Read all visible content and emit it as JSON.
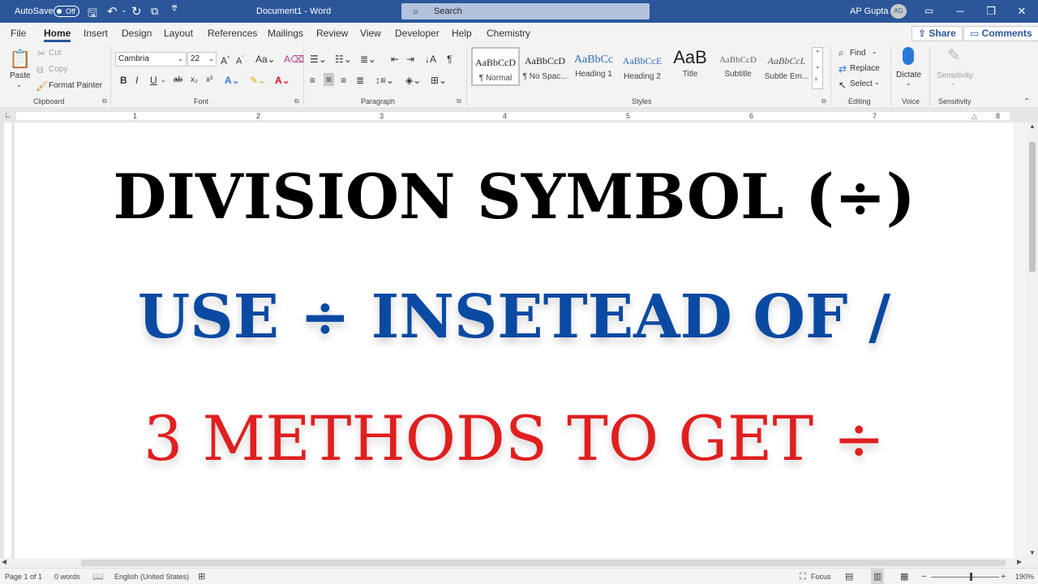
{
  "titlebar": {
    "autosave_label": "AutoSave",
    "autosave_state": "Off",
    "doc_title": "Document1  -  Word",
    "search_placeholder": "Search",
    "user_name": "AP Gupta",
    "user_initials": "AG"
  },
  "menu": {
    "tabs": [
      "File",
      "Home",
      "Insert",
      "Design",
      "Layout",
      "References",
      "Mailings",
      "Review",
      "View",
      "Developer",
      "Help",
      "Chemistry"
    ],
    "active_tab": "Home",
    "share_label": "Share",
    "comments_label": "Comments"
  },
  "ribbon": {
    "clipboard": {
      "paste_label": "Paste",
      "cut_label": "Cut",
      "copy_label": "Copy",
      "format_painter_label": "Format Painter",
      "group_label": "Clipboard"
    },
    "font": {
      "font_name": "Cambria",
      "font_size": "22",
      "group_label": "Font"
    },
    "paragraph": {
      "group_label": "Paragraph"
    },
    "styles": {
      "items": [
        {
          "sample": "AaBbCcD",
          "name": "¶ Normal"
        },
        {
          "sample": "AaBbCcD",
          "name": "¶ No Spac..."
        },
        {
          "sample": "AaBbCc",
          "name": "Heading 1"
        },
        {
          "sample": "AaBbCcE",
          "name": "Heading 2"
        },
        {
          "sample": "AaB",
          "name": "Title"
        },
        {
          "sample": "AaBbCcD",
          "name": "Subtitle"
        },
        {
          "sample": "AaBbCcL",
          "name": "Subtle Em..."
        }
      ],
      "group_label": "Styles"
    },
    "editing": {
      "find_label": "Find",
      "replace_label": "Replace",
      "select_label": "Select",
      "group_label": "Editing"
    },
    "voice": {
      "dictate_label": "Dictate",
      "group_label": "Voice"
    },
    "sensitivity": {
      "button_label": "Sensitivity",
      "group_label": "Sensitivity"
    }
  },
  "ruler": {
    "numbers": [
      "1",
      "2",
      "3",
      "4",
      "5",
      "6",
      "7",
      "8"
    ]
  },
  "document": {
    "line1": "DIVISION SYMBOL (÷)",
    "line2": "USE ÷ INSETEAD OF /",
    "line3": "3 METHODS TO GET ÷"
  },
  "status": {
    "page": "Page 1 of 1",
    "words": "0 words",
    "language": "English (United States)",
    "focus": "Focus",
    "zoom": "190%"
  }
}
